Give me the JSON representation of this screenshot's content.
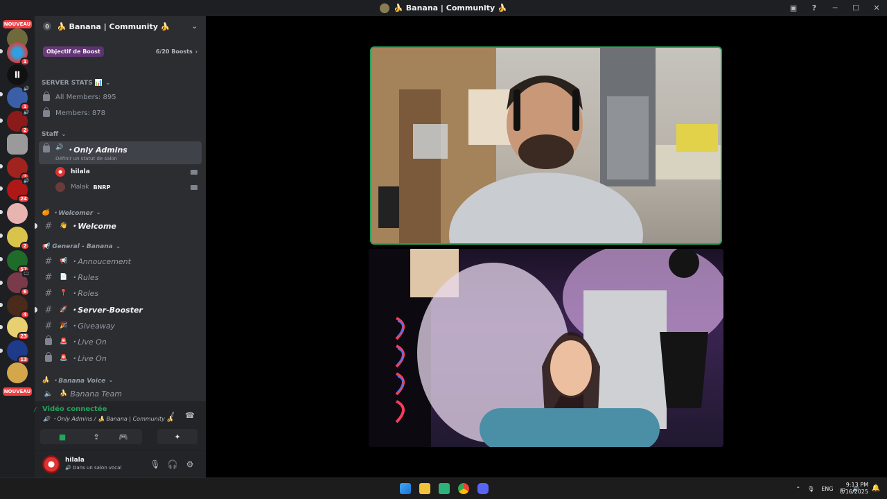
{
  "window": {
    "title": "🍌 Banana | Community 🍌",
    "buttons": [
      "minimize",
      "maximize",
      "close"
    ]
  },
  "servers": {
    "new_label": "NOUVEAU",
    "badges": [
      "1",
      "1",
      "2",
      "2",
      "24",
      "2",
      "57",
      "6",
      "4",
      "23",
      "13"
    ]
  },
  "guild": {
    "unread_count": "0",
    "name": "🍌 Banana | Community 🍌",
    "boost_label": "Objectif de Boost",
    "boost_count": "6/20 Boosts",
    "chevron": "›"
  },
  "channels": {
    "server_stats_category": "SERVER STATS 📊",
    "all_members": "All Members: 895",
    "members": "Members: 878",
    "staff_category": "Staff",
    "only_admins": "・Only Admins",
    "only_admins_status": "Définir un statut de salon",
    "voice_members": [
      {
        "name": "hilala",
        "tag": ""
      },
      {
        "name": "Malak",
        "tag": "BNRP"
      }
    ],
    "welcomer_category": "・Welcomer",
    "welcome": "・Welcome",
    "general_category": "General - Banana",
    "annoucement": "・Annoucement",
    "rules": "・Rules",
    "roles": "・Roles",
    "server_booster": "・Server-Booster",
    "giveaway": "・Giveaway",
    "live_on_1": "・Live On",
    "live_on_2": "・Live On",
    "banana_voice_category": "・Banana Voice",
    "banana_team": "Banana Team"
  },
  "voice_panel": {
    "status": "Vidéo connectée",
    "channel_path": "・Only Admins / 🍌 Banana | Community 🍌"
  },
  "user_panel": {
    "username": "hilala",
    "status": "Dans un salon vocal"
  },
  "taskbar": {
    "language": "ENG",
    "time": "9:13 PM",
    "date": "8/16/2025"
  },
  "colors": {
    "speaking_border": "#23a55a",
    "sidebar_bg": "#2b2d31",
    "server_list_bg": "#1e1f22",
    "notification_red": "#f23f43"
  }
}
